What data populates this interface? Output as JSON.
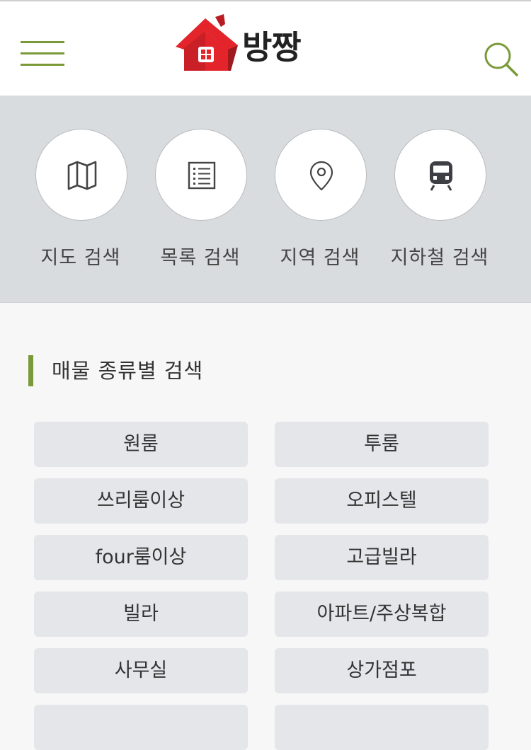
{
  "header": {
    "logo_text": "방짱",
    "accent_color": "#7a9a3a",
    "logo_color": "#e3242b"
  },
  "quick_search": {
    "items": [
      {
        "label": "지도 검색",
        "icon": "map-icon"
      },
      {
        "label": "목록 검색",
        "icon": "list-icon"
      },
      {
        "label": "지역 검색",
        "icon": "location-pin-icon"
      },
      {
        "label": "지하철 검색",
        "icon": "subway-icon"
      }
    ]
  },
  "property_types": {
    "title": "매물 종류별 검색",
    "items": [
      "원룸",
      "투룸",
      "쓰리룸이상",
      "오피스텔",
      "four룸이상",
      "고급빌라",
      "빌라",
      "아파트/주상복합",
      "사무실",
      "상가점포"
    ]
  }
}
